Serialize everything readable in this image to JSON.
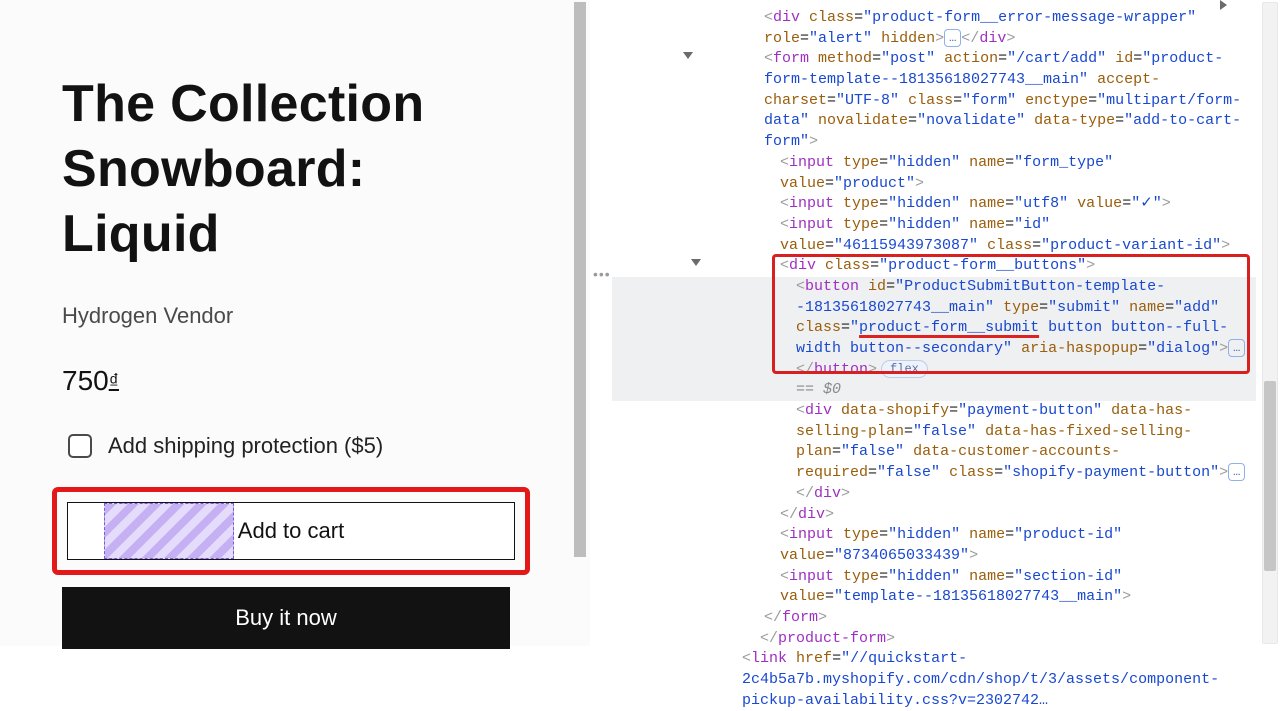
{
  "product": {
    "title": "The Collection Snowboard: Liquid",
    "vendor": "Hydrogen Vendor",
    "price_value": "750",
    "price_currency_symbol": "₫",
    "shipping_protection_label": "Add shipping protection ($5)",
    "add_to_cart_label": "Add to cart",
    "buy_now_label": "Buy it now"
  },
  "devtools": {
    "ellipsis": "…",
    "flex_pill": "flex",
    "eq0": "== $0",
    "lines": {
      "div_error_wrapper": "<div class=\"product-form__error-message-wrapper\" role=\"alert\" hidden>…</div>",
      "form_open": "<form method=\"post\" action=\"/cart/add\" id=\"product-form-template--18135618027743__main\" accept-charset=\"UTF-8\" class=\"form\" enctype=\"multipart/form-data\" novalidate=\"novalidate\" data-type=\"add-to-cart-form\">",
      "input_formtype": "<input type=\"hidden\" name=\"form_type\" value=\"product\">",
      "input_utf8": "<input type=\"hidden\" name=\"utf8\" value=\"✓\">",
      "input_variant": "<input type=\"hidden\" name=\"id\" value=\"46115943973087\" class=\"product-variant-id\">",
      "div_buttons_open": "<div class=\"product-form__buttons\">",
      "button_open": "<button id=\"ProductSubmitButton-template--18135618027743__main\" type=\"submit\" name=\"add\" class=\"product-form__submit button button--full-width button--secondary\" aria-haspopup=\"dialog\">…</button>",
      "div_payment": "<div data-shopify=\"payment-button\" data-has-selling-plan=\"false\" data-has-fixed-selling-plan=\"false\" data-customer-accounts-required=\"false\" class=\"shopify-payment-button\">…</div>",
      "div_close": "</div>",
      "input_product_id": "<input type=\"hidden\" name=\"product-id\" value=\"8734065033439\">",
      "input_section_id": "<input type=\"hidden\" name=\"section-id\" value=\"template--18135618027743__main\">",
      "form_close": "</form>",
      "product_form_close": "</product-form>",
      "link_line": "<link href=\"//quickstart-2c4b5a7b.myshopify.com/cdn/shop/t/3/assets/component-pickup-availability.css?v=2302742…"
    }
  }
}
